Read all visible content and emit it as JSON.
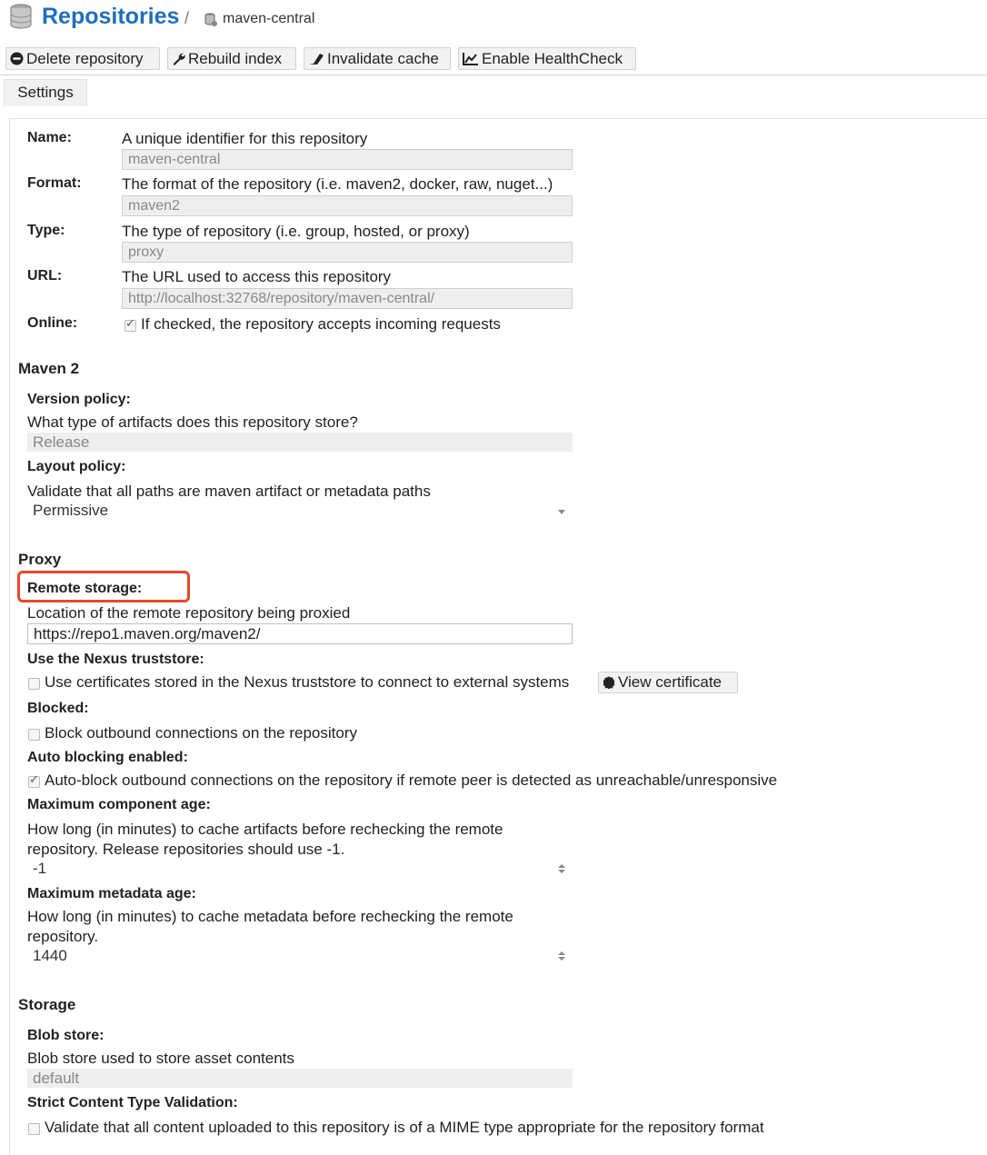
{
  "header": {
    "title": "Repositories",
    "separator": "/",
    "breadcrumb": "maven-central"
  },
  "toolbar": {
    "delete": "Delete repository",
    "rebuild": "Rebuild index",
    "invalidate": "Invalidate cache",
    "healthcheck": "Enable HealthCheck"
  },
  "tabs": {
    "settings": "Settings"
  },
  "general": {
    "name_label": "Name:",
    "name_desc": "A unique identifier for this repository",
    "name_value": "maven-central",
    "format_label": "Format:",
    "format_desc": "The format of the repository (i.e. maven2, docker, raw, nuget...)",
    "format_value": "maven2",
    "type_label": "Type:",
    "type_desc": "The type of repository (i.e. group, hosted, or proxy)",
    "type_value": "proxy",
    "url_label": "URL:",
    "url_desc": "The URL used to access this repository",
    "url_value": "http://localhost:32768/repository/maven-central/",
    "online_label": "Online:",
    "online_desc": "If checked, the repository accepts incoming requests",
    "online_checked": true
  },
  "maven": {
    "heading": "Maven 2",
    "version_label": "Version policy:",
    "version_desc": "What type of artifacts does this repository store?",
    "version_value": "Release",
    "layout_label": "Layout policy:",
    "layout_desc": "Validate that all paths are maven artifact or metadata paths",
    "layout_value": "Permissive"
  },
  "proxy": {
    "heading": "Proxy",
    "remote_label": "Remote storage:",
    "remote_desc": "Location of the remote repository being proxied",
    "remote_value": "https://repo1.maven.org/maven2/",
    "truststore_label": "Use the Nexus truststore:",
    "truststore_desc": "Use certificates stored in the Nexus truststore to connect to external systems",
    "truststore_checked": false,
    "view_cert": "View certificate",
    "blocked_label": "Blocked:",
    "blocked_desc": "Block outbound connections on the repository",
    "blocked_checked": false,
    "autoblock_label": "Auto blocking enabled:",
    "autoblock_desc": "Auto-block outbound connections on the repository if remote peer is detected as unreachable/unresponsive",
    "autoblock_checked": true,
    "comp_age_label": "Maximum component age:",
    "comp_age_desc1": "How long (in minutes) to cache artifacts before rechecking the remote",
    "comp_age_desc2": "repository. Release repositories should use -1.",
    "comp_age_value": "-1",
    "meta_age_label": "Maximum metadata age:",
    "meta_age_desc1": "How long (in minutes) to cache metadata before rechecking the remote",
    "meta_age_desc2": "repository.",
    "meta_age_value": "1440"
  },
  "storage": {
    "heading": "Storage",
    "blob_label": "Blob store:",
    "blob_desc": "Blob store used to store asset contents",
    "blob_value": "default",
    "strict_label": "Strict Content Type Validation:",
    "strict_desc": "Validate that all content uploaded to this repository is of a MIME type appropriate for the repository format",
    "strict_checked": false
  },
  "colors": {
    "title": "#1f6fb8",
    "highlight": "#e8492a"
  }
}
